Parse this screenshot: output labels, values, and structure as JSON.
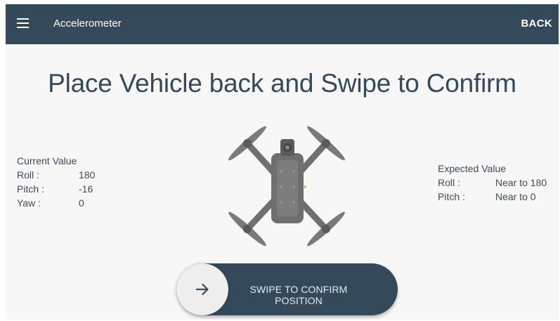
{
  "appbar": {
    "menu_icon": "hamburger-menu-icon",
    "title": "Accelerometer",
    "back_label": "BACK"
  },
  "headline": "Place Vehicle back and Swipe to Confirm",
  "current_value": {
    "title": "Current Value",
    "rows": [
      {
        "label": "Roll :",
        "value": "180"
      },
      {
        "label": "Pitch :",
        "value": "-16"
      },
      {
        "label": "Yaw :",
        "value": "0"
      }
    ]
  },
  "expected_value": {
    "title": "Expected Value",
    "rows": [
      {
        "label": "Roll :",
        "value": "Near to 180"
      },
      {
        "label": "Pitch :",
        "value": "Near to 0"
      }
    ]
  },
  "swipe": {
    "arrow_icon": "arrow-right-icon",
    "label": "SWIPE TO CONFIRM POSITION"
  },
  "colors": {
    "appbar": "#34495a",
    "headline": "#34495a",
    "swipe_track": "#34495a",
    "drone": "#6f6f6f"
  }
}
